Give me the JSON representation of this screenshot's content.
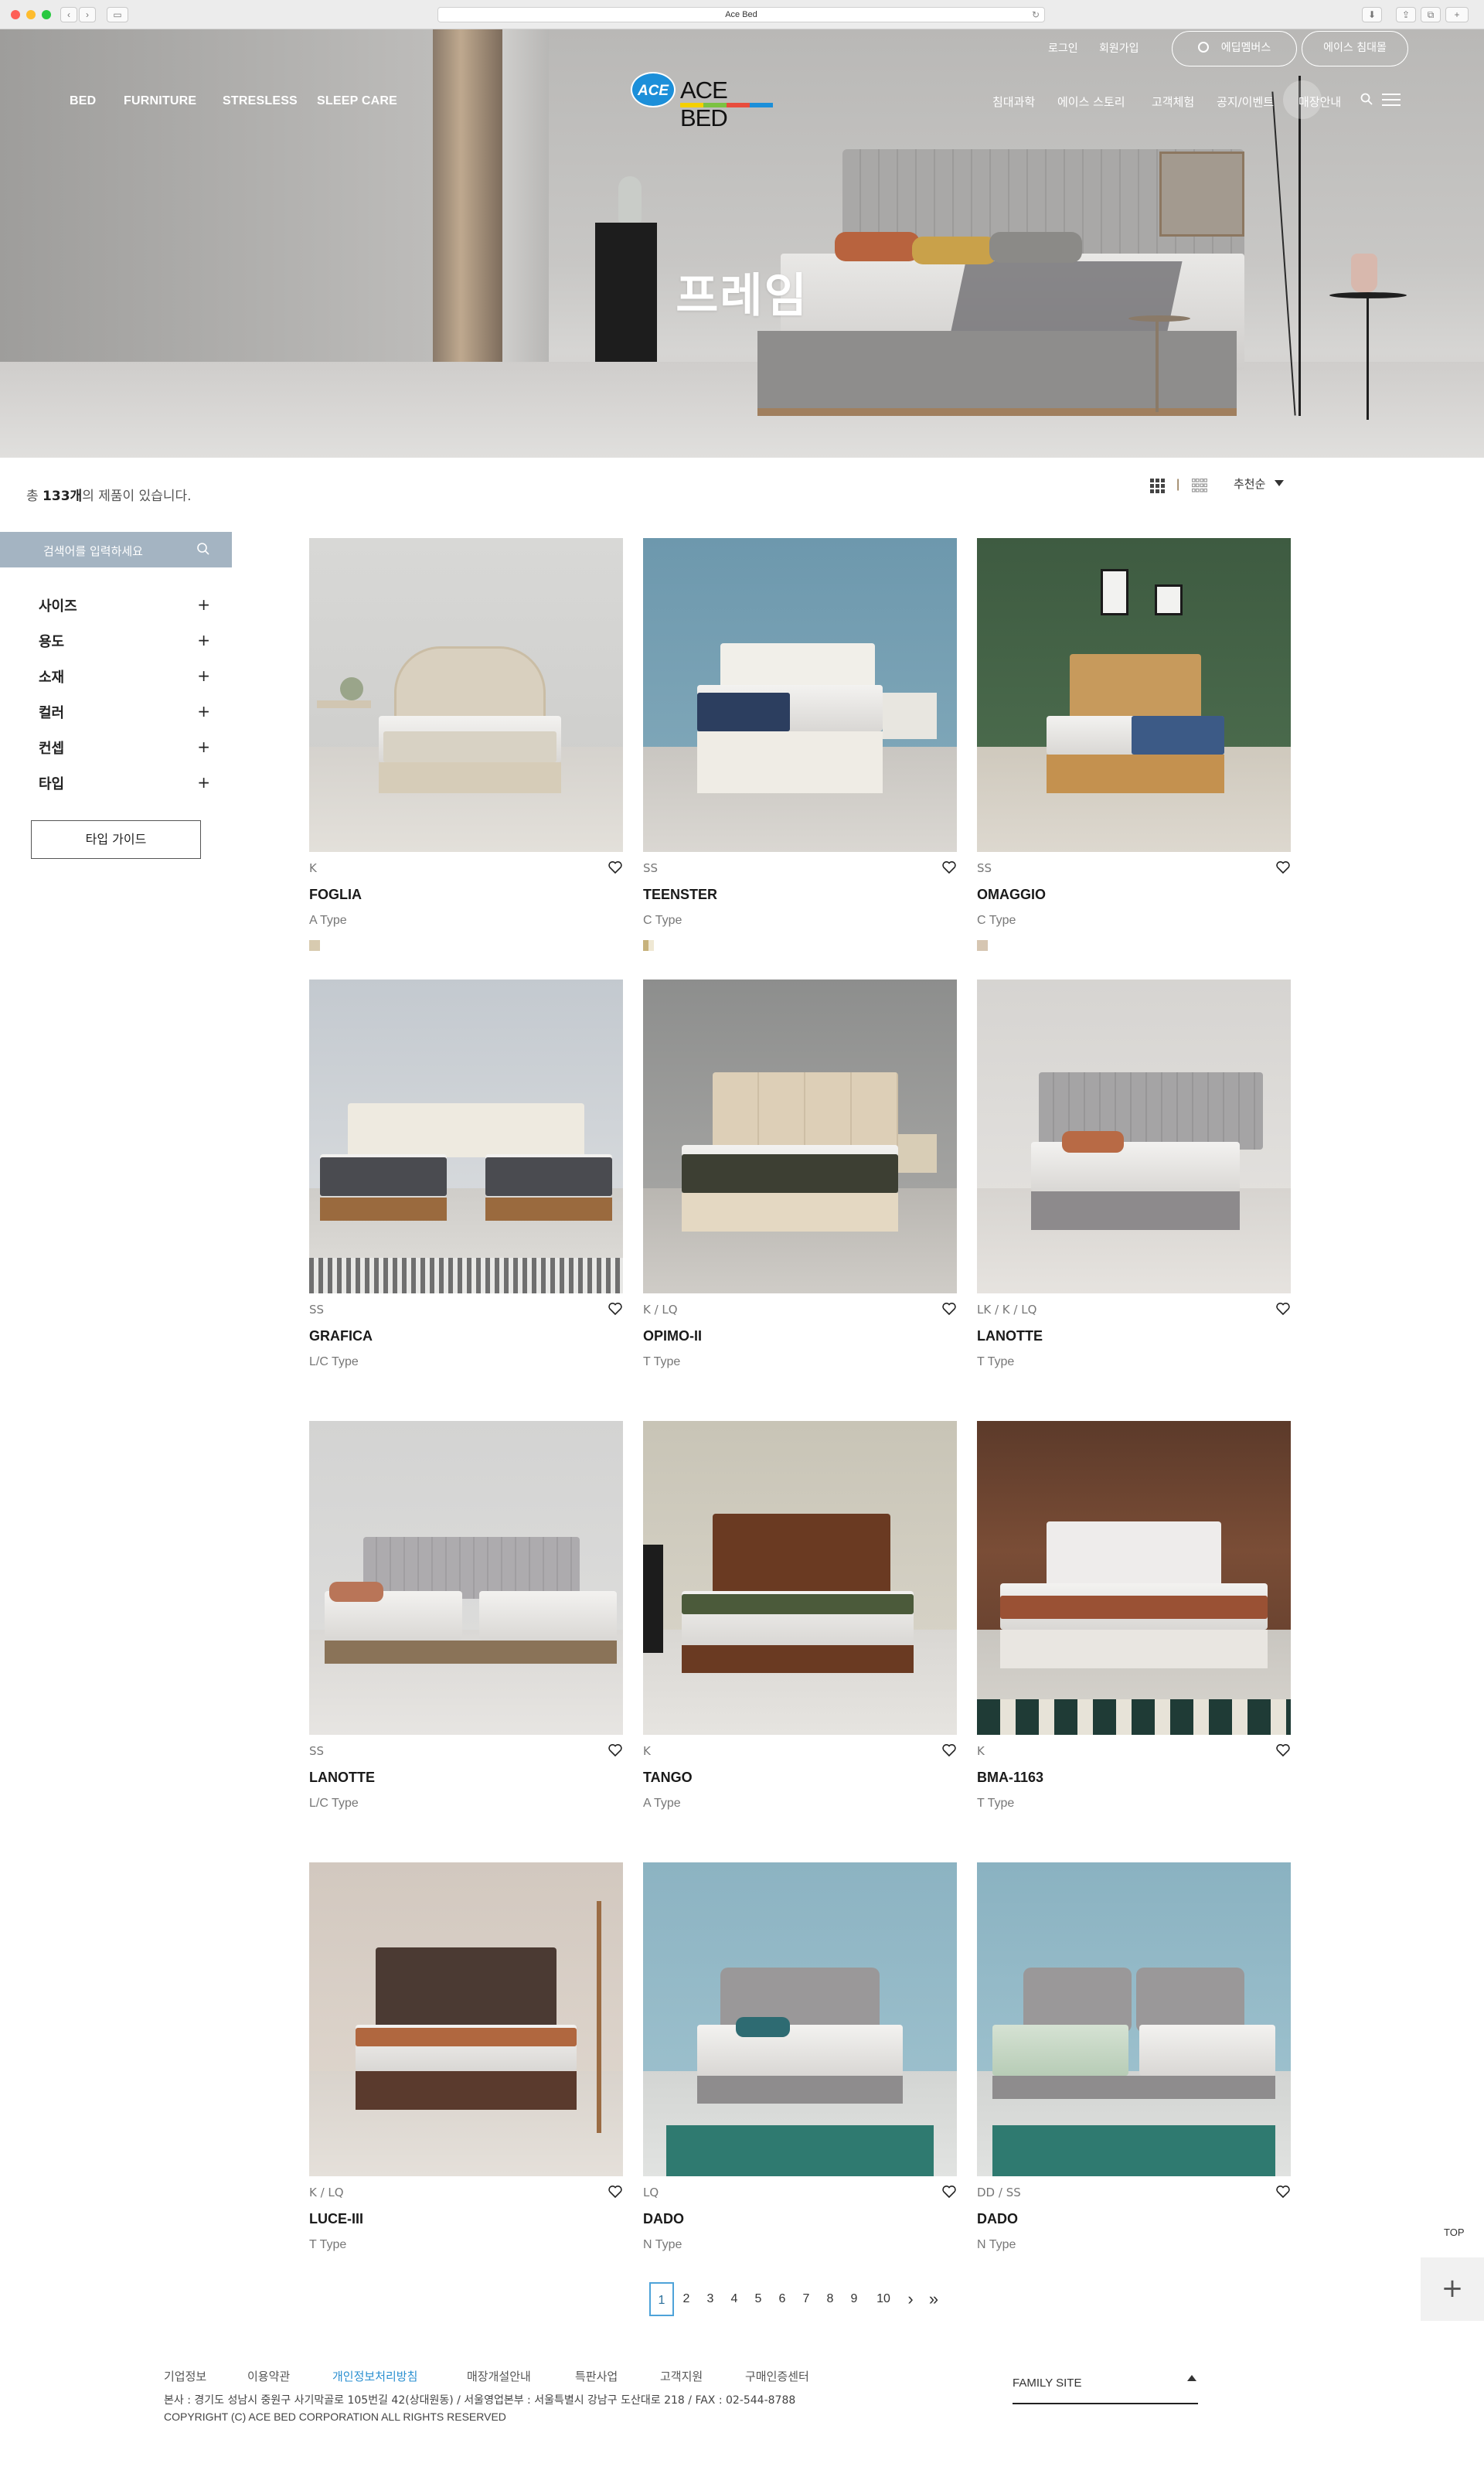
{
  "browser": {
    "url_title": "Ace Bed"
  },
  "hero": {
    "title": "프레임"
  },
  "header": {
    "login": "로그인",
    "signup": "회원가입",
    "membership": "에딥멤버스",
    "consult": "에이스 침대몰",
    "logo_badge": "ACE",
    "logo_text": "ACE BED",
    "left_nav": [
      "BED",
      "FURNITURE",
      "STRESLESS",
      "SLEEP CARE"
    ],
    "right_nav": [
      "침대과학",
      "에이스 스토리",
      "고객체험",
      "공지/이벤트",
      "매장안내"
    ],
    "search_icon": "search-icon",
    "menu_icon": "hamburger-icon"
  },
  "toolbar": {
    "count_prefix": "총 ",
    "count_value": "133개",
    "count_suffix": "의 제품이 있습니다.",
    "sort_label": "추천순"
  },
  "sidebar": {
    "search_placeholder": "검색어를 입력하세요",
    "filters": [
      "사이즈",
      "용도",
      "소재",
      "컬러",
      "컨셉",
      "타입"
    ],
    "filter_toggle": "+",
    "type_guide": "타입 가이드"
  },
  "products": [
    {
      "size": "K",
      "name": "FOGLIA",
      "type": "A Type",
      "swatch": "#d8cbb0"
    },
    {
      "size": "SS",
      "name": "TEENSTER",
      "type": "C Type",
      "swatch": "#d9c79a"
    },
    {
      "size": "SS",
      "name": "OMAGGIO",
      "type": "C Type",
      "swatch": "#d6c6b2"
    },
    {
      "size": "SS",
      "name": "GRAFICA",
      "type": "L/C Type",
      "swatch": ""
    },
    {
      "size": "K / LQ",
      "name": "OPIMO-II",
      "type": "T Type",
      "swatch": ""
    },
    {
      "size": "LK / K / LQ",
      "name": "LANOTTE",
      "type": "T Type",
      "swatch": ""
    },
    {
      "size": "SS",
      "name": "LANOTTE",
      "type": "L/C Type",
      "swatch": ""
    },
    {
      "size": "K",
      "name": "TANGO",
      "type": "A Type",
      "swatch": ""
    },
    {
      "size": "K",
      "name": "BMA-1163",
      "type": "T Type",
      "swatch": ""
    },
    {
      "size": "K / LQ",
      "name": "LUCE-III",
      "type": "T Type",
      "swatch": ""
    },
    {
      "size": "LQ",
      "name": "DADO",
      "type": "N Type",
      "swatch": ""
    },
    {
      "size": "DD / SS",
      "name": "DADO",
      "type": "N Type",
      "swatch": ""
    }
  ],
  "pagination": {
    "pages": [
      "1",
      "2",
      "3",
      "4",
      "5",
      "6",
      "7",
      "8",
      "9",
      "10"
    ],
    "current": "1",
    "next": "›",
    "last": "»"
  },
  "floating": {
    "top_label": "TOP",
    "plus": "+"
  },
  "footer": {
    "links": [
      "기업정보",
      "이용약관",
      "개인정보처리방침",
      "매장개설안내",
      "특판사업",
      "고객지원",
      "구매인증센터"
    ],
    "active_link": "개인정보처리방침",
    "address": "본사 : 경기도 성남시 중원구 사기막골로 105번길 42(상대원동) / 서울영업본부 : 서울특별시 강남구 도산대로 218 / FAX : 02-544-8788",
    "copyright": "COPYRIGHT (C) ACE BED CORPORATION ALL RIGHTS RESERVED",
    "family_site": "FAMILY SITE"
  }
}
